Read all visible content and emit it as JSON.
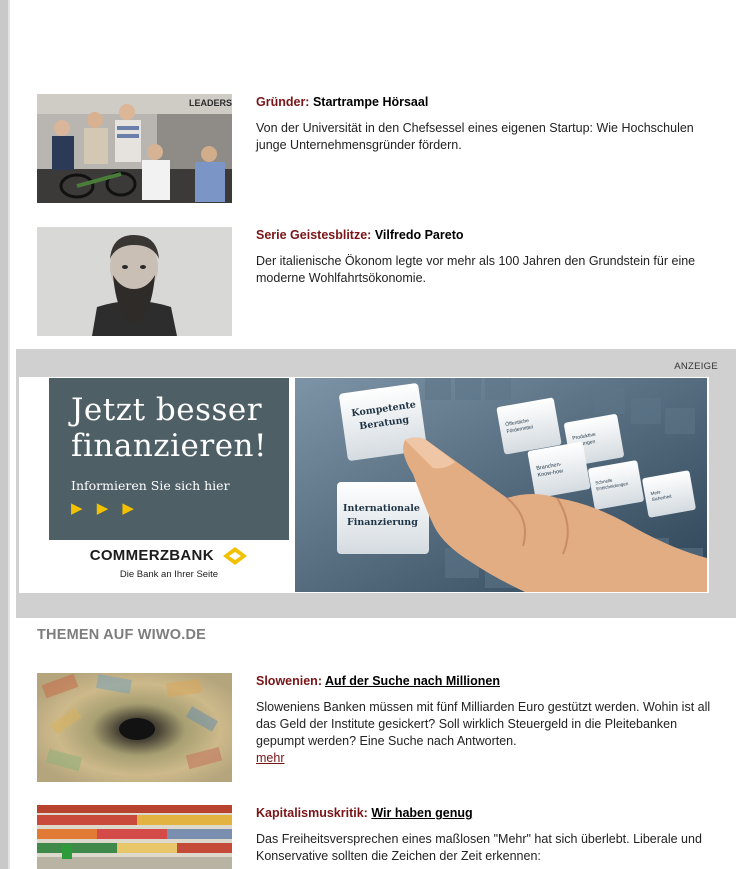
{
  "articles": [
    {
      "kicker": "Gründer:",
      "title": "Startrampe Hörsaal",
      "body": "Von der Universität in den Chefsessel eines eigenen Startup: Wie Hochschulen junge Unternehmensgründer fördern.",
      "image_text": "LEADERS"
    },
    {
      "kicker": "Serie Geistesblitze:",
      "title": "Vilfredo Pareto",
      "body": "Der italienische Ökonom legte vor mehr als 100 Jahren den Grundstein für eine moderne Wohlfahrtsökonomie."
    }
  ],
  "ad": {
    "label": "ANZEIGE",
    "headline_line1": "Jetzt besser",
    "headline_line2": "finanzieren!",
    "subline": "Informieren Sie sich hier",
    "arrows": "▶ ▶ ▶",
    "brand": "COMMERZBANK",
    "tagline": "Die Bank an Ihrer Seite",
    "keys": {
      "key1_line1": "Kompetente",
      "key1_line2": "Beratung",
      "key2_line1": "Internationale",
      "key2_line2": "Finanzierung",
      "small1_line1": "Öffentliche",
      "small1_line2": "Fördermittel",
      "small2_line1": "Produktive",
      "small2_line2": "Lösungen",
      "small3_line1": "Branchen-",
      "small3_line2": "Know-how",
      "small4_line1": "Schnelle",
      "small4_line2": "Entscheidungen",
      "small5_line1": "Mehr",
      "small5_line2": "Sicherheit"
    }
  },
  "section_title": "THEMEN AUF WIWO.DE",
  "themen": [
    {
      "kicker": "Slowenien:",
      "title": "Auf der Suche nach Millionen",
      "body": "Sloweniens Banken müssen mit fünf Milliarden Euro gestützt werden. Wohin ist all das Geld der Institute gesickert? Soll wirklich Steuergeld in die Pleitebanken gepumpt werden? Eine Suche nach Antworten.",
      "more": "mehr"
    },
    {
      "kicker": "Kapitalismuskritik:",
      "title": "Wir haben genug",
      "body": "Das Freiheitsversprechen eines maßlosen \"Mehr\" hat sich überlebt. Liberale und Konservative sollten die Zeichen der Zeit erkennen:"
    }
  ],
  "colors": {
    "kicker": "#7a1517",
    "band": "#d0d0d0",
    "ad_panel": "#4e5f66",
    "ad_accent": "#f2c200",
    "section_title": "#7d7d7d"
  }
}
